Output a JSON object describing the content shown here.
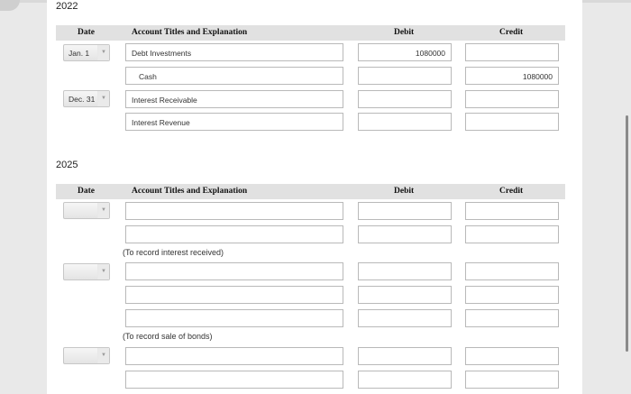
{
  "sections": [
    {
      "year": "2022",
      "headers": {
        "date": "Date",
        "account": "Account Titles and Explanation",
        "debit": "Debit",
        "credit": "Credit"
      },
      "rows": [
        {
          "date": "Jan. 1",
          "account": "Debt Investments",
          "debit": "1080000",
          "credit": ""
        },
        {
          "date": "",
          "account": "Cash",
          "debit": "",
          "credit": "1080000"
        },
        {
          "date": "Dec. 31",
          "account": "Interest Receivable",
          "debit": "",
          "credit": ""
        },
        {
          "date": "",
          "account": "Interest Revenue",
          "debit": "",
          "credit": ""
        }
      ]
    },
    {
      "year": "2025",
      "headers": {
        "date": "Date",
        "account": "Account Titles and Explanation",
        "debit": "Debit",
        "credit": "Credit"
      },
      "notes": [
        "(To record interest received)",
        "(To record sale of bonds)"
      ]
    }
  ]
}
